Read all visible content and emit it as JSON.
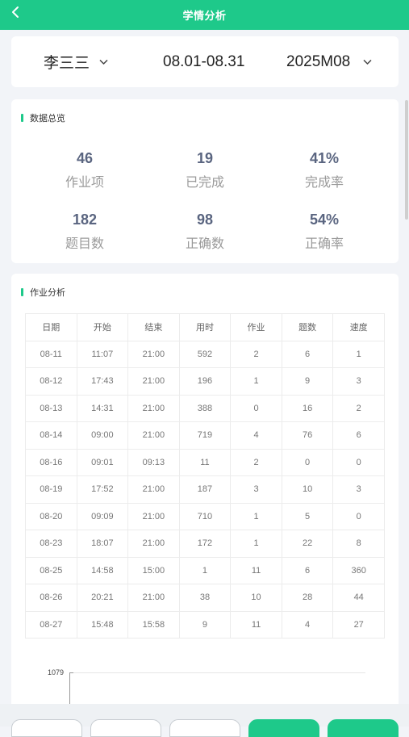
{
  "header": {
    "title": "学情分析"
  },
  "filters": {
    "student": "李三三",
    "date_range": "08.01-08.31",
    "month": "2025M08"
  },
  "overview": {
    "title": "数据总览",
    "stats": [
      {
        "value": "46",
        "label": "作业项"
      },
      {
        "value": "19",
        "label": "已完成"
      },
      {
        "value": "41%",
        "label": "完成率"
      },
      {
        "value": "182",
        "label": "题目数"
      },
      {
        "value": "98",
        "label": "正确数"
      },
      {
        "value": "54%",
        "label": "正确率"
      }
    ]
  },
  "analysis": {
    "title": "作业分析",
    "columns": [
      "日期",
      "开始",
      "结束",
      "用时",
      "作业",
      "题数",
      "速度"
    ],
    "rows": [
      [
        "08-11",
        "11:07",
        "21:00",
        "592",
        "2",
        "6",
        "1"
      ],
      [
        "08-12",
        "17:43",
        "21:00",
        "196",
        "1",
        "9",
        "3"
      ],
      [
        "08-13",
        "14:31",
        "21:00",
        "388",
        "0",
        "16",
        "2"
      ],
      [
        "08-14",
        "09:00",
        "21:00",
        "719",
        "4",
        "76",
        "6"
      ],
      [
        "08-16",
        "09:01",
        "09:13",
        "11",
        "2",
        "0",
        "0"
      ],
      [
        "08-19",
        "17:52",
        "21:00",
        "187",
        "3",
        "10",
        "3"
      ],
      [
        "08-20",
        "09:09",
        "21:00",
        "710",
        "1",
        "5",
        "0"
      ],
      [
        "08-23",
        "18:07",
        "21:00",
        "172",
        "1",
        "22",
        "8"
      ],
      [
        "08-25",
        "14:58",
        "15:00",
        "1",
        "11",
        "6",
        "360"
      ],
      [
        "08-26",
        "20:21",
        "21:00",
        "38",
        "10",
        "28",
        "44"
      ],
      [
        "08-27",
        "15:48",
        "15:58",
        "9",
        "11",
        "4",
        "27"
      ]
    ],
    "chart_axis_max": "1079"
  },
  "bottom_buttons": [
    {
      "label": "",
      "primary": false
    },
    {
      "label": "",
      "primary": false
    },
    {
      "label": "",
      "primary": false
    },
    {
      "label": "",
      "primary": true
    },
    {
      "label": "",
      "primary": true
    }
  ],
  "colors": {
    "accent": "#1ec98a",
    "stat_value": "#5a6580",
    "label": "#9a9a9a"
  }
}
